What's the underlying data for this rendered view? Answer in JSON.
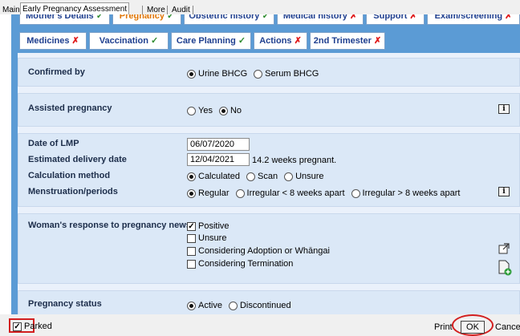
{
  "top_tabs": [
    "Main",
    "Early Pregnancy Assessment",
    "More",
    "Audit"
  ],
  "inner_tabs_row1": [
    {
      "label": "Mother's Details",
      "status": "✓",
      "state": "ok"
    },
    {
      "label": "Pregnancy",
      "status": "✓",
      "state": "ok"
    },
    {
      "label": "Obstetric history",
      "status": "✓",
      "state": "ok"
    },
    {
      "label": "Medical history",
      "status": "✗",
      "state": "bad"
    },
    {
      "label": "Support",
      "status": "✗",
      "state": "bad"
    },
    {
      "label": "Exam/screening",
      "status": "✗",
      "state": "bad"
    }
  ],
  "inner_tabs_row2": [
    {
      "label": "Medicines",
      "status": "✗",
      "state": "bad"
    },
    {
      "label": "Vaccination",
      "status": "✓",
      "state": "ok"
    },
    {
      "label": "Care Planning",
      "status": "✓",
      "state": "ok"
    },
    {
      "label": "Actions",
      "status": "✗",
      "state": "bad"
    },
    {
      "label": "2nd Trimester",
      "status": "✗",
      "state": "bad"
    }
  ],
  "confirmed_by": {
    "label": "Confirmed by",
    "options": [
      "Urine BHCG",
      "Serum BHCG"
    ],
    "selected": "Urine BHCG"
  },
  "assisted": {
    "label": "Assisted pregnancy",
    "options": [
      "Yes",
      "No"
    ],
    "selected": "No"
  },
  "dates": {
    "lmp_label": "Date of LMP",
    "lmp_value": "06/07/2020",
    "edd_label": "Estimated delivery date",
    "edd_value": "12/04/2021",
    "weeks_text": "14.2 weeks pregnant.",
    "calc_label": "Calculation method",
    "calc_options": [
      "Calculated",
      "Scan",
      "Unsure"
    ],
    "calc_selected": "Calculated",
    "mens_label": "Menstruation/periods",
    "mens_options": [
      "Regular",
      "Irregular < 8 weeks apart",
      "Irregular > 8 weeks apart"
    ],
    "mens_selected": "Regular"
  },
  "response": {
    "label": "Woman's response to pregnancy news",
    "options": [
      "Positive",
      "Unsure",
      "Considering Adoption or Whāngai",
      "Considering Termination"
    ],
    "checked": [
      "Positive"
    ]
  },
  "status": {
    "label": "Pregnancy status",
    "options": [
      "Active",
      "Discontinued"
    ],
    "selected": "Active"
  },
  "bottom": {
    "parked_label": "Parked",
    "parked_checked": true,
    "print_label": "Print",
    "ok_label": "OK",
    "cancel_label": "Cancel"
  },
  "icons": {
    "info": "info-icon",
    "external_link": "external-link-icon",
    "add_document": "add-document-icon"
  }
}
